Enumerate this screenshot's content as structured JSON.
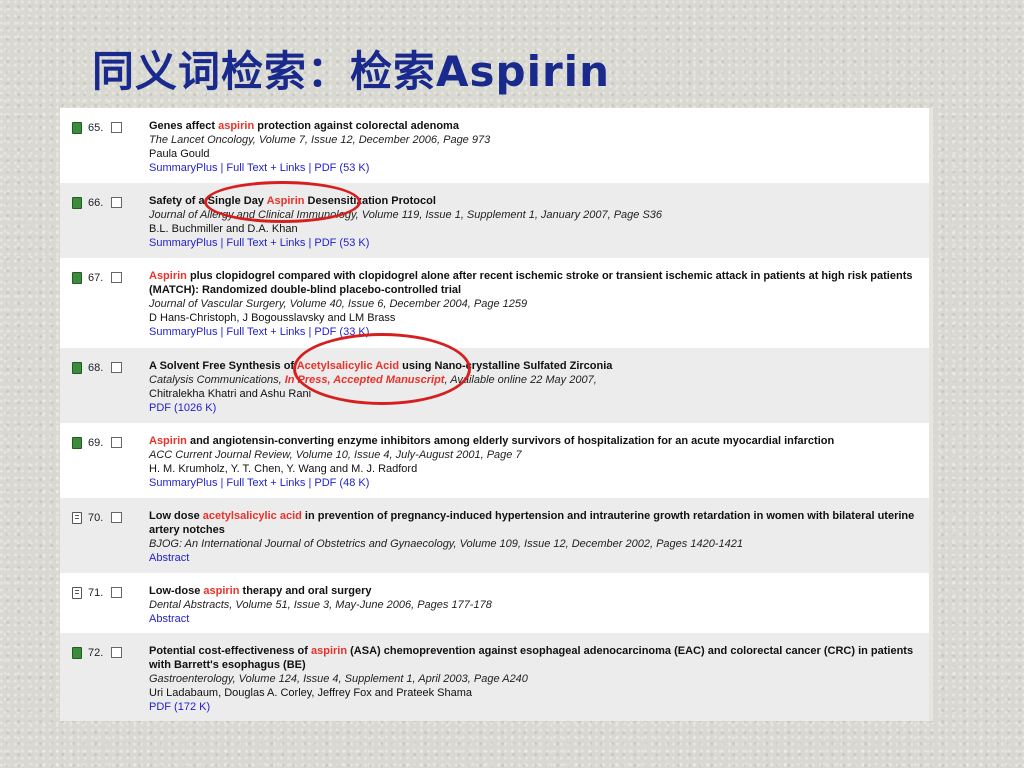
{
  "slide": {
    "title": "同义词检索：检索Aspirin",
    "colors": {
      "title": "#1a2a8c",
      "highlight": "#e8322a",
      "link": "#2222cc",
      "annotation": "#d61f1f"
    }
  },
  "results": [
    {
      "num": "65.",
      "icon": "full-text-icon",
      "title_pre": "Genes affect ",
      "title_hl": "aspirin",
      "title_post": " protection against colorectal adenoma",
      "journal_pre": "The Lancet Oncology, Volume 7, Issue 12, December 2006, Page 973",
      "journal_press": "",
      "journal_post": "",
      "authors": "Paula Gould",
      "links": "SummaryPlus | Full Text + Links | PDF (53 K)"
    },
    {
      "num": "66.",
      "icon": "full-text-icon",
      "title_pre": "Safety of a Single Day ",
      "title_hl": "Aspirin",
      "title_post": " Desensitization Protocol",
      "journal_pre": "Journal of Allergy and Clinical Immunology, Volume 119, Issue 1, Supplement 1, January 2007, Page S36",
      "journal_press": "",
      "journal_post": "",
      "authors": "B.L. Buchmiller and D.A. Khan",
      "links": "SummaryPlus | Full Text + Links | PDF (53 K)"
    },
    {
      "num": "67.",
      "icon": "full-text-icon",
      "title_pre": "",
      "title_hl": "Aspirin",
      "title_post": " plus clopidogrel compared with clopidogrel alone after recent ischemic stroke or transient ischemic attack in patients at high risk patients (MATCH): Randomized double-blind placebo-controlled trial",
      "journal_pre": "Journal of Vascular Surgery, Volume 40, Issue 6, December 2004, Page 1259",
      "journal_press": "",
      "journal_post": "",
      "authors": "D Hans-Christoph, J Bogousslavsky and LM Brass",
      "links": "SummaryPlus | Full Text + Links | PDF (33 K)"
    },
    {
      "num": "68.",
      "icon": "full-text-icon",
      "title_pre": "A Solvent Free Synthesis of ",
      "title_hl": "Acetylsalicylic Acid",
      "title_post": " using Nano-crystalline Sulfated Zirconia",
      "journal_pre": "Catalysis Communications, ",
      "journal_press": "In Press, Accepted Manuscript",
      "journal_post": ", Available online 22 May 2007,",
      "authors": "Chitralekha Khatri and Ashu Rani",
      "links": "PDF (1026 K)"
    },
    {
      "num": "69.",
      "icon": "full-text-icon",
      "title_pre": "",
      "title_hl": "Aspirin",
      "title_post": " and angiotensin-converting enzyme inhibitors among elderly survivors of hospitalization for an acute myocardial infarction",
      "journal_pre": "ACC Current Journal Review, Volume 10, Issue 4, July-August 2001, Page 7",
      "journal_press": "",
      "journal_post": "",
      "authors": "H. M. Krumholz, Y. T. Chen, Y. Wang and M. J. Radford",
      "links": "SummaryPlus | Full Text + Links | PDF (48 K)"
    },
    {
      "num": "70.",
      "icon": "abstract-icon",
      "title_pre": "Low dose ",
      "title_hl": "acetylsalicylic acid",
      "title_post": " in prevention of pregnancy-induced hypertension and intrauterine growth retardation in women with bilateral uterine artery notches",
      "journal_pre": "BJOG: An International Journal of Obstetrics and Gynaecology, Volume 109, Issue 12, December 2002, Pages 1420-1421",
      "journal_press": "",
      "journal_post": "",
      "authors": "",
      "links": "Abstract"
    },
    {
      "num": "71.",
      "icon": "abstract-icon",
      "title_pre": "Low-dose ",
      "title_hl": "aspirin",
      "title_post": " therapy and oral surgery",
      "journal_pre": "Dental Abstracts, Volume 51, Issue 3, May-June 2006, Pages 177-178",
      "journal_press": "",
      "journal_post": "",
      "authors": "",
      "links": "Abstract"
    },
    {
      "num": "72.",
      "icon": "full-text-icon",
      "title_pre": "Potential cost-effectiveness of ",
      "title_hl": "aspirin",
      "title_post": " (ASA) chemoprevention against esophageal adenocarcinoma (EAC) and colorectal cancer (CRC) in patients with Barrett's esophagus (BE)",
      "journal_pre": "Gastroenterology, Volume 124, Issue 4, Supplement 1, April 2003, Page A240",
      "journal_press": "",
      "journal_post": "",
      "authors": "Uri Ladabaum, Douglas A. Corley, Jeffrey Fox and Prateek Shama",
      "links": "PDF (172 K)"
    }
  ]
}
